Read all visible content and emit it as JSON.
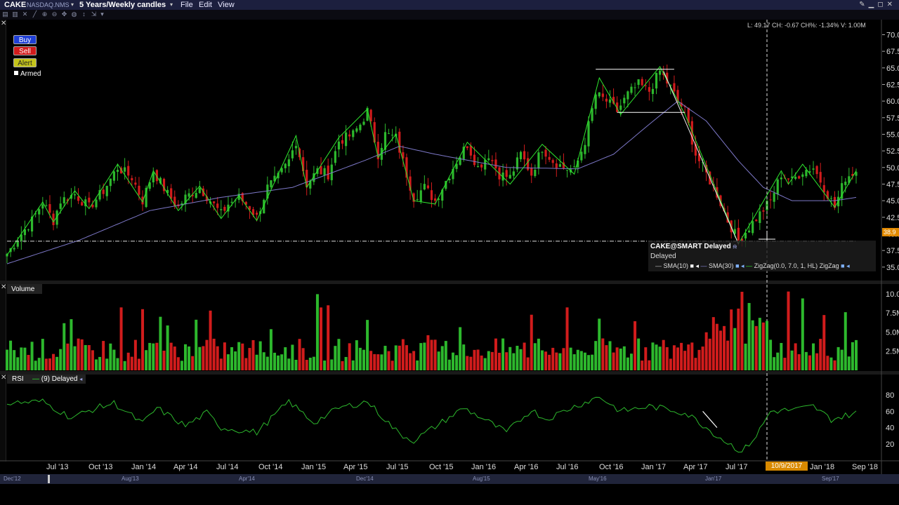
{
  "title_bar": {
    "symbol": "CAKE",
    "exchange": "NASDAQ.NMS",
    "period": "5 Years/Weekly candles",
    "menus": [
      "File",
      "Edit",
      "View"
    ]
  },
  "order_buttons": {
    "buy": "Buy",
    "sell": "Sell",
    "alert": "Alert",
    "armed": "Armed"
  },
  "readout": "L: 49.17 CH: -0.67 CH%: -1.34% V: 1.00M",
  "price_axis": {
    "ticks": [
      "70.0",
      "67.5",
      "65.0",
      "62.5",
      "60.0",
      "57.5",
      "55.0",
      "52.5",
      "50.0",
      "47.5",
      "45.0",
      "42.5",
      "40.0",
      "37.5",
      "35.0"
    ],
    "current_price_box": "38.9"
  },
  "legend": {
    "title": "CAKE@SMART Delayed",
    "subtitle": "Delayed",
    "items": [
      "SMA(10)",
      "SMA(30)",
      "ZigZag(0.0, 7.0, 1, HL)",
      "ZigZag"
    ]
  },
  "volume_pane": {
    "label": "Volume",
    "ticks": [
      "10.0",
      "7.5M",
      "5.0M",
      "2.5M"
    ]
  },
  "rsi_pane": {
    "label": "RSI",
    "params": "(9) Delayed",
    "ticks": [
      "80",
      "60",
      "40",
      "20"
    ]
  },
  "time_axis": {
    "labels": [
      "Jul '13",
      "Oct '13",
      "Jan '14",
      "Apr '14",
      "Jul '14",
      "Oct '14",
      "Jan '15",
      "Apr '15",
      "Jul '15",
      "Oct '15",
      "Jan '16",
      "Apr '16",
      "Jul '16",
      "Oct '16",
      "Jan '17",
      "Apr '17",
      "Jul '17",
      "Jan '18",
      "Sep '18"
    ],
    "cursor_date": "10/9/2017"
  },
  "navigator": {
    "labels": [
      "Dec'12",
      "Aug'13",
      "Apr'14",
      "Dec'14",
      "Aug'15",
      "May'16",
      "Jan'17",
      "Sep'17"
    ]
  },
  "colors": {
    "up": "#2db82d",
    "down": "#d11c1c",
    "sma": "#7d78c8",
    "zigzag": "#2ee62e",
    "background": "#000000"
  },
  "chart_data": {
    "type": "candlestick",
    "price_range": [
      33.5,
      71
    ],
    "volume_range": [
      0,
      11
    ],
    "rsi_range": [
      0,
      100
    ],
    "anchors": [
      [
        0,
        37
      ],
      [
        4,
        40
      ],
      [
        7,
        42
      ],
      [
        10,
        44.8
      ],
      [
        13,
        42
      ],
      [
        15,
        45
      ],
      [
        19,
        46
      ],
      [
        23,
        44
      ],
      [
        27,
        46.5
      ],
      [
        31,
        50
      ],
      [
        35,
        48.5
      ],
      [
        38,
        45
      ],
      [
        41,
        49.5
      ],
      [
        45,
        46
      ],
      [
        48,
        44
      ],
      [
        50,
        45.5
      ],
      [
        54,
        47
      ],
      [
        57,
        45
      ],
      [
        60,
        43
      ],
      [
        62,
        44.5
      ],
      [
        65,
        45.5
      ],
      [
        68,
        44
      ],
      [
        70,
        42.5
      ],
      [
        73,
        47
      ],
      [
        76,
        48.5
      ],
      [
        79,
        51
      ],
      [
        81,
        54
      ],
      [
        84,
        47.5
      ],
      [
        87,
        49.5
      ],
      [
        90,
        49
      ],
      [
        93,
        54
      ],
      [
        97,
        55
      ],
      [
        99,
        56.5
      ],
      [
        101,
        58.5
      ],
      [
        104,
        52
      ],
      [
        106,
        55
      ],
      [
        109,
        54.5
      ],
      [
        112,
        49
      ],
      [
        114,
        45.5
      ],
      [
        117,
        47
      ],
      [
        120,
        45
      ],
      [
        123,
        48
      ],
      [
        126,
        51
      ],
      [
        129,
        53.5
      ],
      [
        132,
        50
      ],
      [
        135,
        52
      ],
      [
        138,
        49
      ],
      [
        141,
        48.5
      ],
      [
        144,
        52
      ],
      [
        147,
        49
      ],
      [
        150,
        53
      ],
      [
        153,
        51
      ],
      [
        156,
        50
      ],
      [
        159,
        49.5
      ],
      [
        162,
        54
      ],
      [
        165,
        61
      ],
      [
        168,
        60
      ],
      [
        171,
        58.5
      ],
      [
        174,
        61
      ],
      [
        177,
        62.5
      ],
      [
        180,
        61.5
      ],
      [
        183,
        64.5
      ],
      [
        186,
        62
      ],
      [
        188,
        60
      ],
      [
        190,
        58.5
      ],
      [
        193,
        52
      ],
      [
        196,
        49
      ],
      [
        199,
        46
      ],
      [
        202,
        42
      ],
      [
        205,
        39
      ],
      [
        208,
        41
      ],
      [
        211,
        43
      ],
      [
        214,
        45
      ],
      [
        217,
        49
      ],
      [
        220,
        48
      ],
      [
        223,
        49.5
      ],
      [
        226,
        50
      ],
      [
        229,
        47
      ],
      [
        232,
        44
      ],
      [
        235,
        48.5
      ],
      [
        238,
        49.5
      ]
    ],
    "sma30_anchors": [
      [
        0,
        35.5
      ],
      [
        20,
        39
      ],
      [
        40,
        43.5
      ],
      [
        60,
        45.5
      ],
      [
        80,
        47
      ],
      [
        100,
        51
      ],
      [
        110,
        53.2
      ],
      [
        120,
        52
      ],
      [
        140,
        50
      ],
      [
        160,
        49.8
      ],
      [
        170,
        52
      ],
      [
        180,
        56.5
      ],
      [
        188,
        60
      ],
      [
        196,
        57
      ],
      [
        205,
        51
      ],
      [
        212,
        47
      ],
      [
        220,
        45
      ],
      [
        232,
        45
      ],
      [
        238,
        45.5
      ]
    ],
    "zigzag": [
      [
        0,
        36.8
      ],
      [
        10,
        44.8
      ],
      [
        13,
        41.8
      ],
      [
        19,
        46.5
      ],
      [
        23,
        43.8
      ],
      [
        31,
        50.5
      ],
      [
        38,
        44.8
      ],
      [
        41,
        49.5
      ],
      [
        48,
        43.5
      ],
      [
        54,
        47.2
      ],
      [
        60,
        42.3
      ],
      [
        65,
        45.8
      ],
      [
        70,
        42
      ],
      [
        81,
        54.8
      ],
      [
        84,
        47
      ],
      [
        93,
        54.5
      ],
      [
        101,
        58.8
      ],
      [
        104,
        51.5
      ],
      [
        109,
        55
      ],
      [
        114,
        45
      ],
      [
        120,
        44.5
      ],
      [
        129,
        53.8
      ],
      [
        141,
        47.5
      ],
      [
        150,
        53.5
      ],
      [
        159,
        49
      ],
      [
        166,
        63.5
      ],
      [
        172,
        58
      ],
      [
        183,
        65.2
      ],
      [
        190,
        58
      ],
      [
        205,
        38.5
      ],
      [
        217,
        49.5
      ],
      [
        219,
        47.5
      ],
      [
        223,
        50.5
      ],
      [
        232,
        44
      ],
      [
        238,
        49.5
      ]
    ],
    "rsi_anchors": [
      [
        0,
        70
      ],
      [
        10,
        72
      ],
      [
        18,
        52
      ],
      [
        25,
        64
      ],
      [
        30,
        70
      ],
      [
        38,
        45
      ],
      [
        42,
        64
      ],
      [
        50,
        42
      ],
      [
        56,
        58
      ],
      [
        60,
        40
      ],
      [
        70,
        34
      ],
      [
        79,
        72
      ],
      [
        86,
        46
      ],
      [
        93,
        64
      ],
      [
        101,
        72
      ],
      [
        110,
        32
      ],
      [
        114,
        24
      ],
      [
        121,
        44
      ],
      [
        128,
        64
      ],
      [
        133,
        52
      ],
      [
        140,
        34
      ],
      [
        147,
        62
      ],
      [
        151,
        50
      ],
      [
        158,
        64
      ],
      [
        166,
        78
      ],
      [
        172,
        60
      ],
      [
        180,
        66
      ],
      [
        186,
        62
      ],
      [
        190,
        58
      ],
      [
        193,
        50
      ],
      [
        199,
        30
      ],
      [
        206,
        10
      ],
      [
        210,
        30
      ],
      [
        214,
        60
      ],
      [
        221,
        62
      ],
      [
        226,
        66
      ],
      [
        231,
        50
      ],
      [
        238,
        58
      ]
    ],
    "horizontal_line": 38.9,
    "cursor_bar": 213,
    "triangle_lines": [
      [
        165,
        64.8,
        187,
        64.8
      ],
      [
        171,
        58.3,
        190,
        58.3
      ]
    ]
  }
}
